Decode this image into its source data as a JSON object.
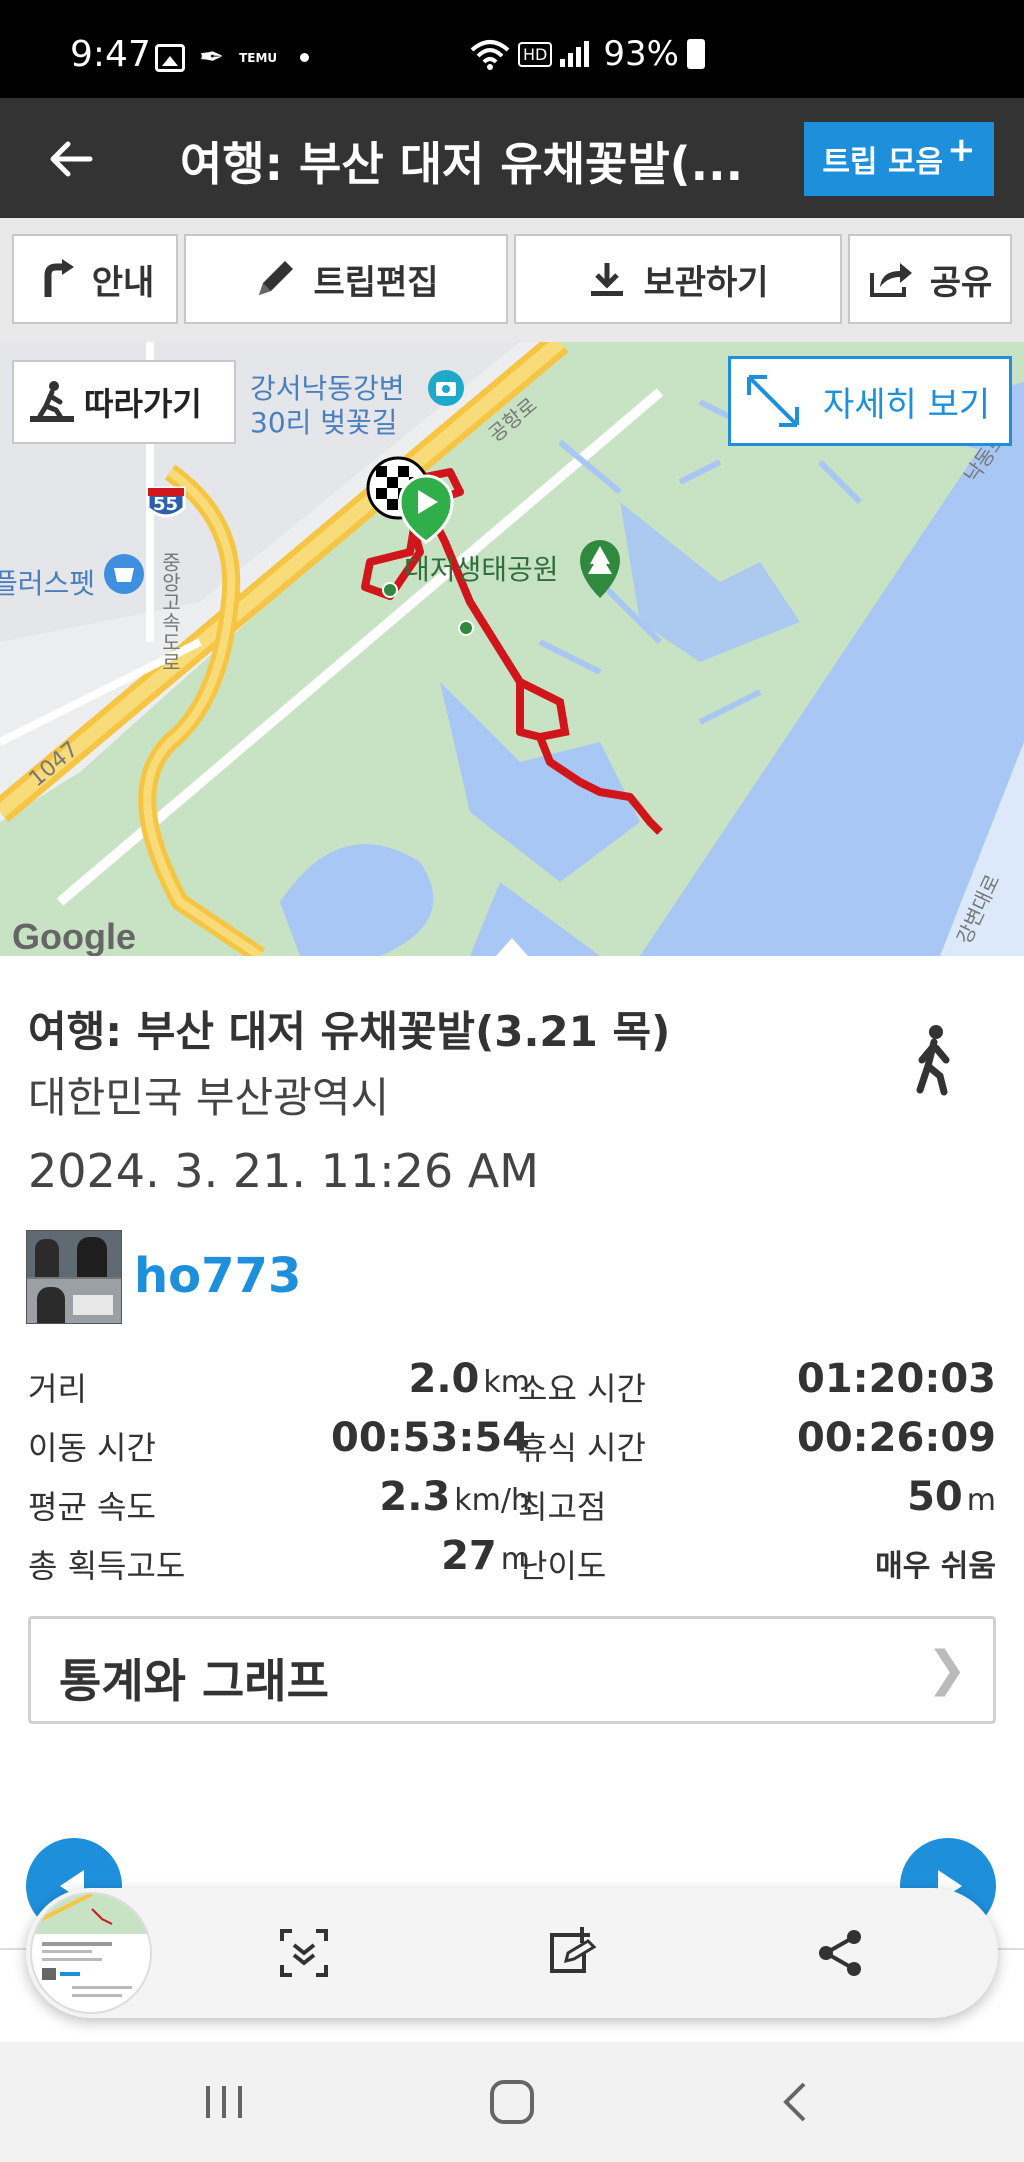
{
  "status_bar": {
    "time": "9:47",
    "notif_temu": "TEMU",
    "battery": "93%",
    "hd": "HD"
  },
  "app_bar": {
    "title": "여행: 부산 대저 유채꽃밭(...",
    "trip_collection_label": "트립 모음",
    "trip_collection_plus": "+"
  },
  "toolbar": {
    "guide": "안내",
    "edit_trip": "트립편집",
    "save": "보관하기",
    "share": "공유"
  },
  "map": {
    "follow_label": "따라가기",
    "detail_label": "자세히 보기",
    "poi_cherry": "강서낙동강변\n30리 벚꽃길",
    "poi_park": "대저생태공원",
    "poi_pet": "플러스펫",
    "road_expressway": "중앙고속도로",
    "road_gonghang": "공항로",
    "road_1047": "1047",
    "road_55": "55",
    "google": "Google",
    "road_bottom": "강변대로",
    "road_topright": "낙동로"
  },
  "trip": {
    "title": "여행: 부산 대저 유채꽃밭(3.21 목)",
    "location": "대한민국 부산광역시",
    "date": "2024. 3. 21. 11:26 AM",
    "username": "ho773",
    "activity_icon": "walking-icon"
  },
  "stats": [
    {
      "label_l": "거리",
      "value_l": "2.0",
      "unit_l": "km",
      "label_r": "소요 시간",
      "value_r": "01:20:03",
      "unit_r": ""
    },
    {
      "label_l": "이동 시간",
      "value_l": "00:53:54",
      "unit_l": "",
      "label_r": "휴식 시간",
      "value_r": "00:26:09",
      "unit_r": ""
    },
    {
      "label_l": "평균 속도",
      "value_l": "2.3",
      "unit_l": "km/h",
      "label_r": "최고점",
      "value_r": "50",
      "unit_r": "m"
    },
    {
      "label_l": "총 획득고도",
      "value_l": "27",
      "unit_l": "m",
      "label_r": "난이도",
      "value_r": "매우 쉬움",
      "unit_r": ""
    }
  ],
  "stats_graph": {
    "label": "통계와 그래프",
    "chevron": "❯"
  },
  "colors": {
    "accent": "#1e90db",
    "app_bar": "#333333",
    "route": "#d0151b"
  }
}
